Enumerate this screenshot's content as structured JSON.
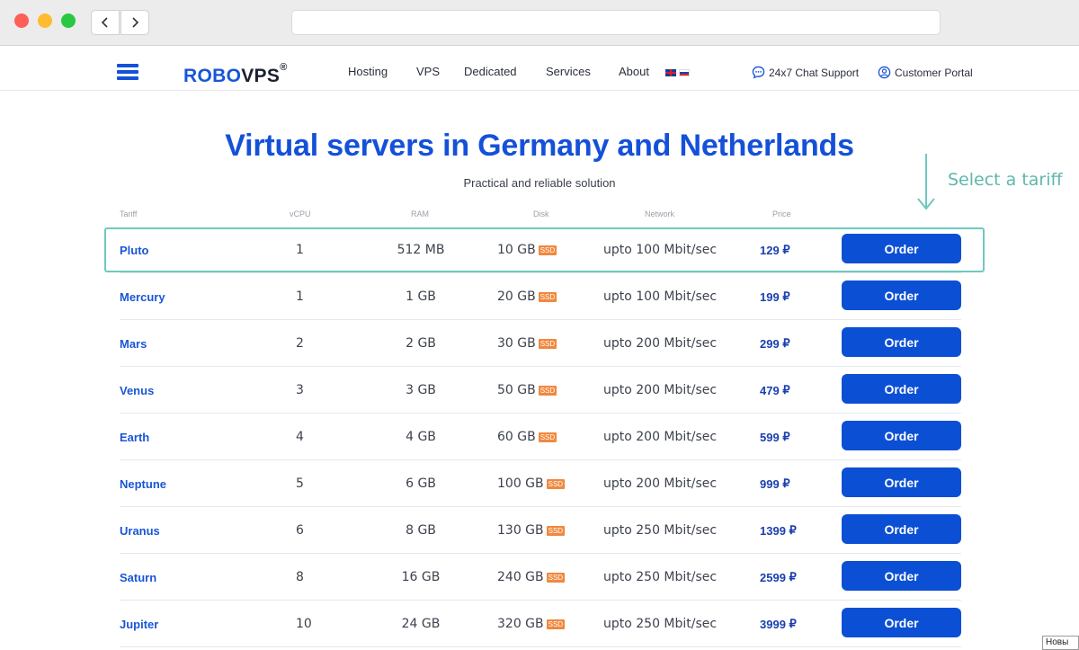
{
  "browser": {
    "url": ""
  },
  "header": {
    "logo_a": "ROBO",
    "logo_b": "VPS",
    "logo_mark": "®",
    "nav": [
      "Hosting",
      "VPS",
      "Dedicated",
      "Services",
      "About"
    ],
    "chat_support": "24x7 Chat Support",
    "customer_portal": "Customer Portal"
  },
  "hero": {
    "title": "Virtual servers in Germany and Netherlands",
    "subtitle": "Practical and reliable solution",
    "hint": "Select a tariff"
  },
  "table": {
    "headers": [
      "Tariff",
      "vCPU",
      "RAM",
      "Disk",
      "Network",
      "Price"
    ],
    "ssd_label": "SSD",
    "order_label": "Order",
    "currency": "₽",
    "rows": [
      {
        "tariff": "Pluto",
        "vcpu": "1",
        "ram": "512 MB",
        "disk": "10 GB",
        "network": "upto 100 Mbit/sec",
        "price": "129"
      },
      {
        "tariff": "Mercury",
        "vcpu": "1",
        "ram": "1 GB",
        "disk": "20 GB",
        "network": "upto 100 Mbit/sec",
        "price": "199"
      },
      {
        "tariff": "Mars",
        "vcpu": "2",
        "ram": "2 GB",
        "disk": "30 GB",
        "network": "upto 200 Mbit/sec",
        "price": "299"
      },
      {
        "tariff": "Venus",
        "vcpu": "3",
        "ram": "3 GB",
        "disk": "50 GB",
        "network": "upto 200 Mbit/sec",
        "price": "479"
      },
      {
        "tariff": "Earth",
        "vcpu": "4",
        "ram": "4 GB",
        "disk": "60 GB",
        "network": "upto 200 Mbit/sec",
        "price": "599"
      },
      {
        "tariff": "Neptune",
        "vcpu": "5",
        "ram": "6 GB",
        "disk": "100 GB",
        "network": "upto 200 Mbit/sec",
        "price": "999"
      },
      {
        "tariff": "Uranus",
        "vcpu": "6",
        "ram": "8 GB",
        "disk": "130 GB",
        "network": "upto 250 Mbit/sec",
        "price": "1399"
      },
      {
        "tariff": "Saturn",
        "vcpu": "8",
        "ram": "16 GB",
        "disk": "240 GB",
        "network": "upto 250 Mbit/sec",
        "price": "2599"
      },
      {
        "tariff": "Jupiter",
        "vcpu": "10",
        "ram": "24 GB",
        "disk": "320 GB",
        "network": "upto 250 Mbit/sec",
        "price": "3999"
      }
    ]
  },
  "corner_badge": "Новы",
  "colors": {
    "brand": "#1451d8",
    "button": "#0b4fd4",
    "highlight": "#6ec9bf",
    "ssd": "#f0883e"
  },
  "icons": [
    "back-icon",
    "forward-icon",
    "hamburger-icon",
    "chat-icon",
    "user-icon",
    "arrow-down-icon",
    "uk-flag-icon",
    "ru-flag-icon"
  ]
}
